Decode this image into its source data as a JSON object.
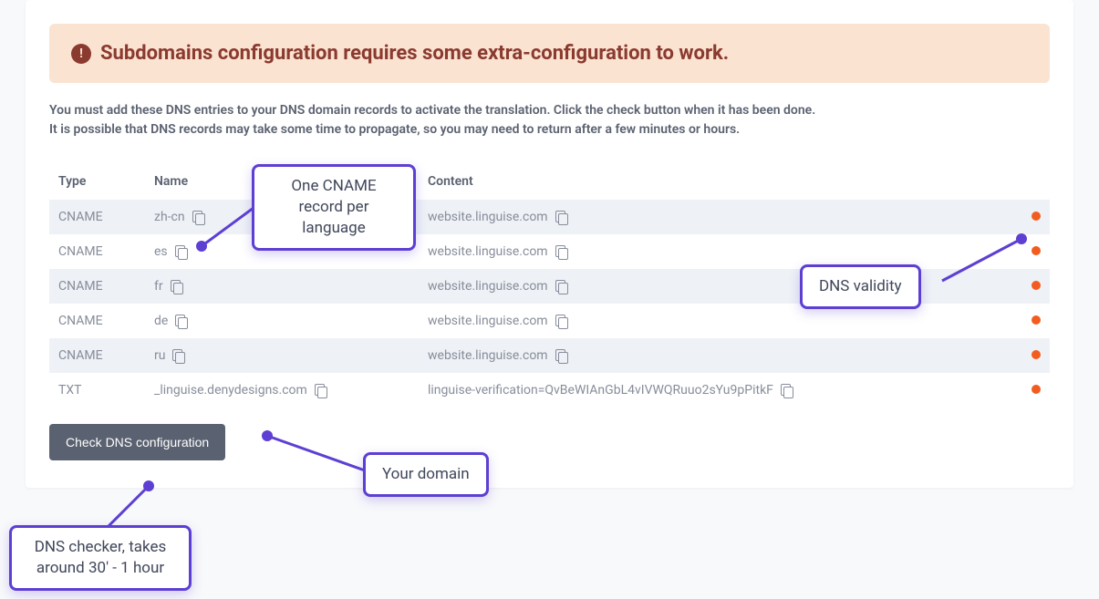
{
  "alert": {
    "title": "Subdomains configuration requires some extra-configuration to work."
  },
  "instructions": {
    "line1": "You must add these DNS entries to your DNS domain records to activate the translation. Click the check button when it has been done.",
    "line2": "It is possible that DNS records may take some time to propagate, so you may need to return after a few minutes or hours."
  },
  "table": {
    "headers": {
      "type": "Type",
      "name": "Name",
      "content": "Content"
    },
    "rows": [
      {
        "type": "CNAME",
        "name": "zh-cn",
        "content": "website.linguise.com"
      },
      {
        "type": "CNAME",
        "name": "es",
        "content": "website.linguise.com"
      },
      {
        "type": "CNAME",
        "name": "fr",
        "content": "website.linguise.com"
      },
      {
        "type": "CNAME",
        "name": "de",
        "content": "website.linguise.com"
      },
      {
        "type": "CNAME",
        "name": "ru",
        "content": "website.linguise.com"
      },
      {
        "type": "TXT",
        "name": "_linguise.denydesigns.com",
        "content": "linguise-verification=QvBeWIAnGbL4vIVWQRuuo2sYu9pPitkF"
      }
    ]
  },
  "buttons": {
    "check_dns": "Check DNS configuration"
  },
  "annotations": {
    "cname_per_lang": "One CNAME record per language",
    "dns_validity": "DNS validity",
    "your_domain": "Your domain",
    "dns_checker": "DNS checker, takes around 30' - 1 hour"
  }
}
